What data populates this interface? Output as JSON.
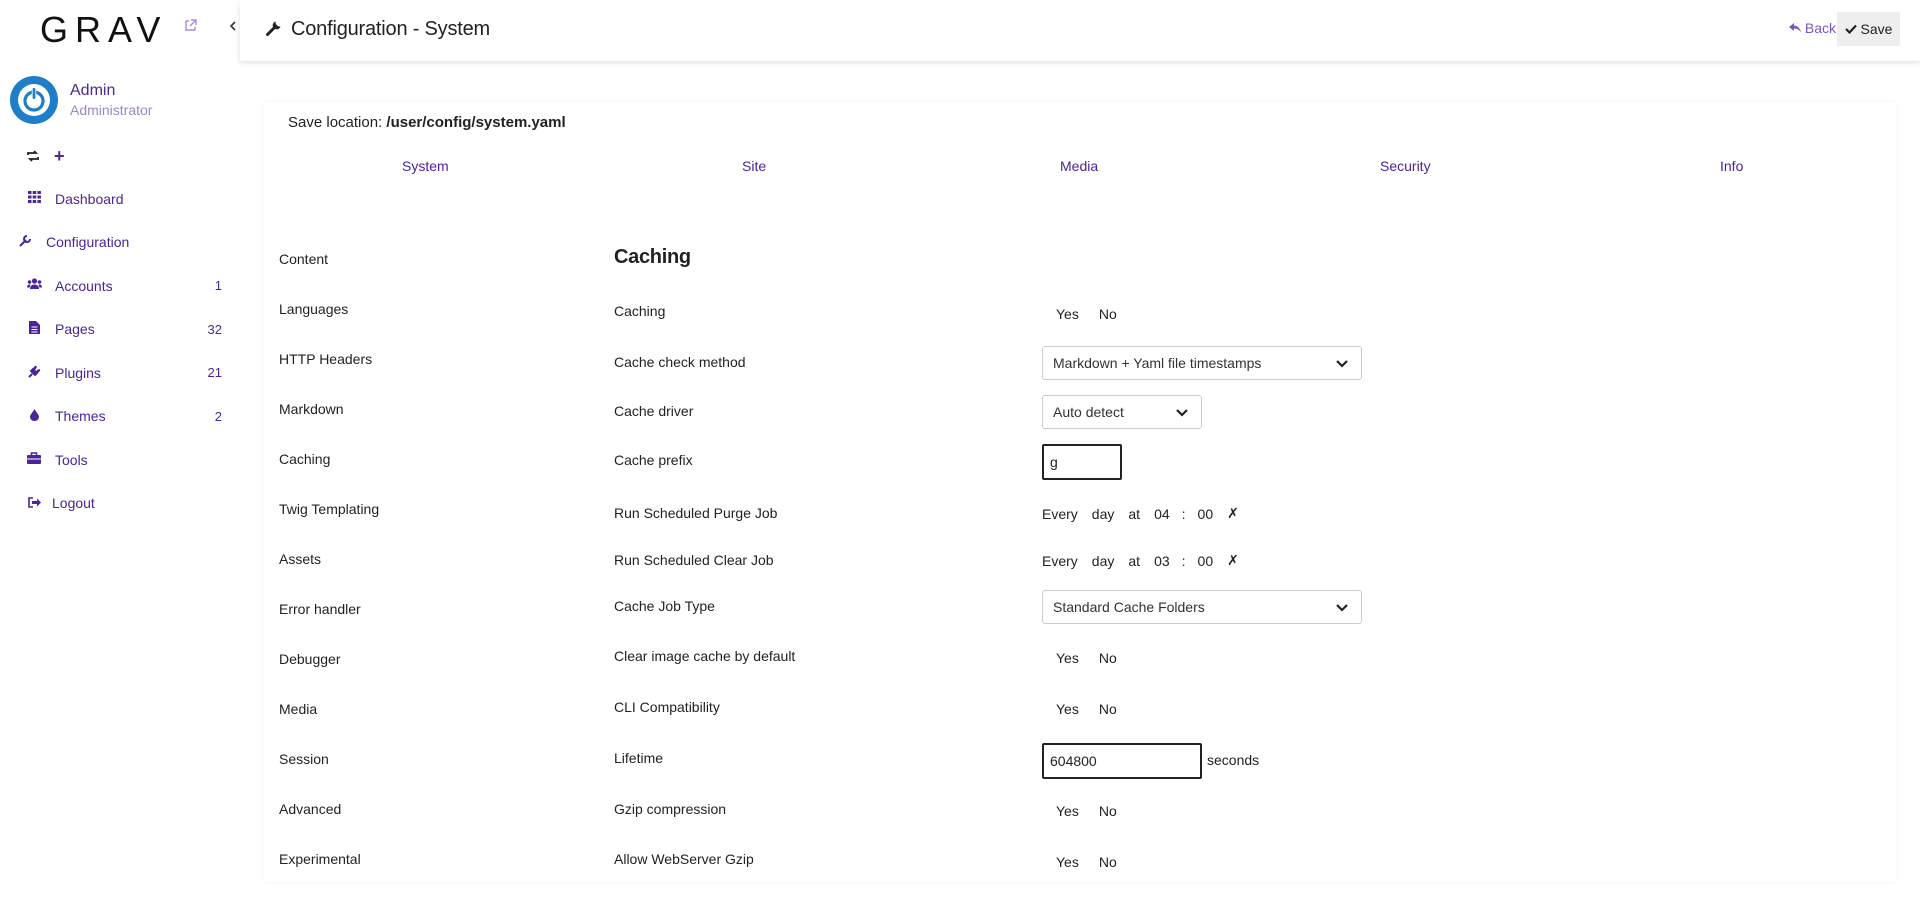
{
  "sidebar": {
    "logo": "GRAV",
    "user": {
      "name": "Admin",
      "role": "Administrator"
    },
    "nav": [
      {
        "label": "Dashboard",
        "icon": "grid-icon",
        "count": ""
      },
      {
        "label": "Configuration",
        "icon": "wrench-icon",
        "count": ""
      },
      {
        "label": "Accounts",
        "icon": "users-icon",
        "count": "1"
      },
      {
        "label": "Pages",
        "icon": "file-icon",
        "count": "32"
      },
      {
        "label": "Plugins",
        "icon": "plug-icon",
        "count": "21"
      },
      {
        "label": "Themes",
        "icon": "tint-icon",
        "count": "2"
      },
      {
        "label": "Tools",
        "icon": "briefcase-icon",
        "count": ""
      },
      {
        "label": "Logout",
        "icon": "sign-out-icon",
        "count": ""
      }
    ]
  },
  "header": {
    "title": "Configuration - System",
    "back_label": "Back",
    "save_label": "Save"
  },
  "content": {
    "save_location_label": "Save location:",
    "save_location_path": "/user/config/system.yaml",
    "tabs": [
      "System",
      "Site",
      "Media",
      "Security",
      "Info"
    ],
    "subnav": [
      "Content",
      "Languages",
      "HTTP Headers",
      "Markdown",
      "Caching",
      "Twig Templating",
      "Assets",
      "Error handler",
      "Debugger",
      "Media",
      "Session",
      "Advanced",
      "Experimental"
    ],
    "section_title": "Caching",
    "fields": {
      "caching": {
        "label": "Caching",
        "yes": "Yes",
        "no": "No"
      },
      "cache_check": {
        "label": "Cache check method",
        "value": "Markdown + Yaml file timestamps"
      },
      "cache_driver": {
        "label": "Cache driver",
        "value": "Auto detect"
      },
      "cache_prefix": {
        "label": "Cache prefix",
        "value": "g"
      },
      "purge_job": {
        "label": "Run Scheduled Purge Job",
        "every": "Every",
        "unit": "day",
        "at": "at",
        "hour": "04",
        "sep": ":",
        "minute": "00",
        "clear": "✗"
      },
      "clear_job": {
        "label": "Run Scheduled Clear Job",
        "every": "Every",
        "unit": "day",
        "at": "at",
        "hour": "03",
        "sep": ":",
        "minute": "00",
        "clear": "✗"
      },
      "cache_job_type": {
        "label": "Cache Job Type",
        "value": "Standard Cache Folders"
      },
      "clear_image_cache": {
        "label": "Clear image cache by default",
        "yes": "Yes",
        "no": "No"
      },
      "cli_compat": {
        "label": "CLI Compatibility",
        "yes": "Yes",
        "no": "No"
      },
      "lifetime": {
        "label": "Lifetime",
        "value": "604800",
        "suffix": "seconds"
      },
      "gzip": {
        "label": "Gzip compression",
        "yes": "Yes",
        "no": "No"
      },
      "webserver_gzip": {
        "label": "Allow WebServer Gzip",
        "yes": "Yes",
        "no": "No"
      }
    }
  },
  "colors": {
    "accent": "#4b2497",
    "avatar": "#1e7fc8",
    "muted": "#9d87c6"
  }
}
